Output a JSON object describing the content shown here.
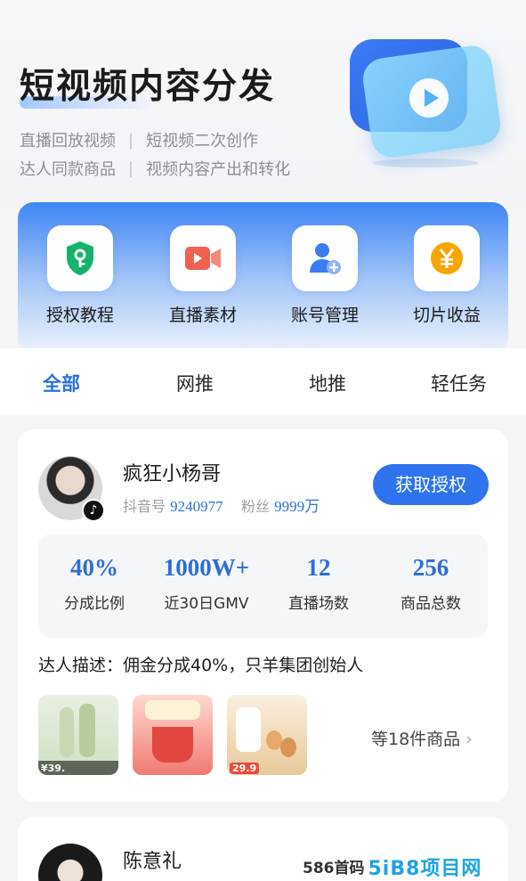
{
  "hero": {
    "title": "短视频内容分发",
    "tags_line1": [
      "直播回放视频",
      "短视频二次创作"
    ],
    "tags_line2": [
      "达人同款商品",
      "视频内容产出和转化"
    ],
    "separator": "|"
  },
  "tools": [
    {
      "label": "授权教程",
      "icon": "shield-key-icon",
      "color": "#14b36b"
    },
    {
      "label": "直播素材",
      "icon": "video-camera-icon",
      "color": "#f06250"
    },
    {
      "label": "账号管理",
      "icon": "user-add-icon",
      "color": "#3b7cf0"
    },
    {
      "label": "切片收益",
      "icon": "yuan-coin-icon",
      "color": "#f7a600"
    }
  ],
  "tabs": [
    {
      "label": "全部",
      "active": true
    },
    {
      "label": "网推",
      "active": false
    },
    {
      "label": "地推",
      "active": false
    },
    {
      "label": "轻任务",
      "active": false
    }
  ],
  "creators": [
    {
      "name": "疯狂小杨哥",
      "douyin_label": "抖音号",
      "douyin_id": "9240977",
      "fans_label": "粉丝",
      "fans": "9999万",
      "auth_button": "获取授权",
      "stats": [
        {
          "value": "40%",
          "label": "分成比例"
        },
        {
          "value": "1000W+",
          "label": "近30日GMV"
        },
        {
          "value": "12",
          "label": "直播场数"
        },
        {
          "value": "256",
          "label": "商品总数"
        }
      ],
      "description": "达人描述：佣金分成40%，只羊集团创始人",
      "products": [
        {
          "price": "¥39."
        },
        {
          "price": ""
        },
        {
          "price": "29.9"
        }
      ],
      "more_products": "等18件商品"
    },
    {
      "name": "陈意礼"
    }
  ],
  "watermark": {
    "text": "586首码",
    "logo": "5iB8项目网"
  }
}
